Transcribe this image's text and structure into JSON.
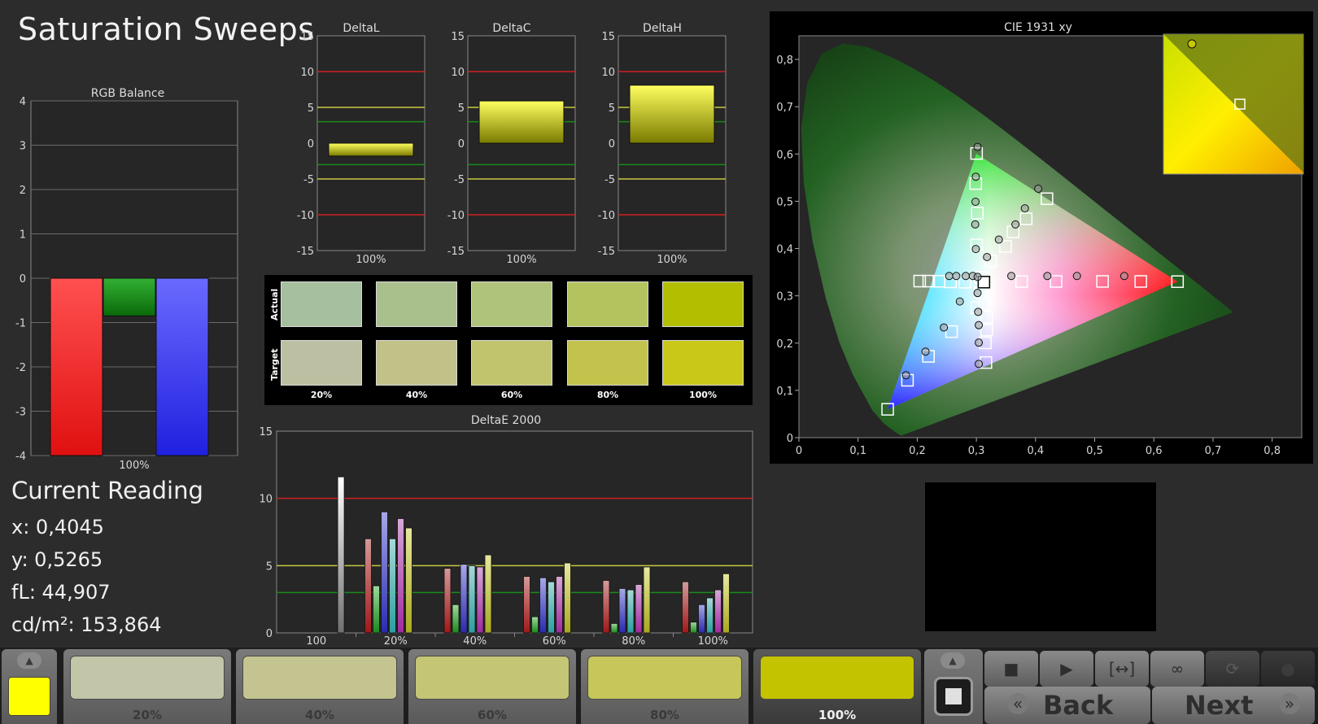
{
  "title": "Saturation Sweeps",
  "current_reading": {
    "heading": "Current Reading",
    "x": "x: 0,4045",
    "y": "y: 0,5265",
    "fl": "fL: 44,907",
    "cdm2": "cd/m²: 153,864"
  },
  "swatches": {
    "row_actual": "Actual",
    "row_target": "Target",
    "labels": [
      "20%",
      "40%",
      "60%",
      "80%",
      "100%"
    ],
    "actual_colors": [
      "#a6bf9e",
      "#aac08c",
      "#b0c37a",
      "#b4c35e",
      "#b3be00"
    ],
    "target_colors": [
      "#bdbfa2",
      "#c0c287",
      "#c1c46c",
      "#c2c24c",
      "#c9c718"
    ]
  },
  "bottom_bar": {
    "current_color": "#ffff00",
    "steps": [
      {
        "label": "20%",
        "color": "#c3c5a9"
      },
      {
        "label": "40%",
        "color": "#c3c48f"
      },
      {
        "label": "60%",
        "color": "#c4c575"
      },
      {
        "label": "80%",
        "color": "#c7c65a"
      },
      {
        "label": "100%",
        "color": "#c4c300",
        "active": true
      }
    ],
    "back_label": "Back",
    "next_label": "Next",
    "icons": [
      "stop-icon",
      "play-icon",
      "fit-icon",
      "loop-icon",
      "refresh-icon",
      "record-icon"
    ]
  },
  "chart_data": [
    {
      "id": "rgb",
      "type": "bar",
      "title": "RGB Balance",
      "categories": [
        "100%"
      ],
      "series": [
        {
          "color": "red",
          "values": [
            -4.0
          ]
        },
        {
          "color": "green",
          "values": [
            -0.85
          ]
        },
        {
          "color": "blue",
          "values": [
            -4.0
          ]
        }
      ],
      "ylim": [
        -4,
        4
      ],
      "yticks": [
        4,
        3,
        2,
        1,
        0,
        -1,
        -2,
        -3,
        -4
      ]
    },
    {
      "id": "deltaL",
      "type": "bar",
      "title": "DeltaL",
      "categories": [
        "100%"
      ],
      "values": [
        -1.8
      ],
      "ylim": [
        -15,
        15
      ],
      "yticks": [
        15,
        10,
        5,
        0,
        -5,
        -10,
        -15
      ]
    },
    {
      "id": "deltaC",
      "type": "bar",
      "title": "DeltaC",
      "categories": [
        "100%"
      ],
      "values": [
        5.9
      ],
      "ylim": [
        -15,
        15
      ],
      "yticks": [
        15,
        10,
        5,
        0,
        -5,
        -10,
        -15
      ]
    },
    {
      "id": "deltaH",
      "type": "bar",
      "title": "DeltaH",
      "categories": [
        "100%"
      ],
      "values": [
        8.1
      ],
      "ylim": [
        -15,
        15
      ],
      "yticks": [
        15,
        10,
        5,
        0,
        -5,
        -10,
        -15
      ]
    },
    {
      "id": "deltaE",
      "type": "bar",
      "title": "DeltaE 2000",
      "categories": [
        "100",
        "20%",
        "40%",
        "60%",
        "80%",
        "100%"
      ],
      "series": [
        {
          "color": "white",
          "values": [
            11.6,
            null,
            null,
            null,
            null,
            null
          ]
        },
        {
          "color": "red",
          "values": [
            null,
            7.0,
            4.8,
            4.2,
            3.9,
            3.8
          ]
        },
        {
          "color": "green",
          "values": [
            null,
            3.5,
            2.1,
            1.2,
            0.7,
            0.8
          ]
        },
        {
          "color": "blue",
          "values": [
            null,
            9.0,
            5.1,
            4.1,
            3.3,
            2.1
          ]
        },
        {
          "color": "cyan",
          "values": [
            null,
            7.0,
            5.0,
            3.8,
            3.2,
            2.6
          ]
        },
        {
          "color": "magenta",
          "values": [
            null,
            8.5,
            4.9,
            4.2,
            3.6,
            3.2
          ]
        },
        {
          "color": "yellow",
          "values": [
            null,
            7.8,
            5.8,
            5.2,
            4.9,
            4.4
          ]
        }
      ],
      "ylim": [
        0,
        15
      ],
      "yticks": [
        15,
        10,
        5,
        0
      ]
    },
    {
      "id": "cie",
      "type": "scatter",
      "title": "CIE 1931 xy",
      "xlim": [
        0,
        0.85
      ],
      "ylim": [
        0,
        0.85
      ],
      "xticks": [
        "0",
        "0,1",
        "0,2",
        "0,3",
        "0,4",
        "0,5",
        "0,6",
        "0,7",
        "0,8"
      ],
      "yticks": [
        "0",
        "0,1",
        "0,2",
        "0,3",
        "0,4",
        "0,5",
        "0,6",
        "0,7",
        "0,8"
      ],
      "gamut": [
        [
          0.64,
          0.33
        ],
        [
          0.3,
          0.6
        ],
        [
          0.15,
          0.06
        ]
      ],
      "white": [
        0.3127,
        0.329
      ],
      "targets": [
        [
          0.3067,
          0.3065
        ],
        [
          0.3137,
          0.2814
        ],
        [
          0.3174,
          0.2545
        ],
        [
          0.3173,
          0.2277
        ],
        [
          0.3151,
          0.2005
        ],
        [
          0.3161,
          0.1589
        ],
        [
          0.3069,
          0.3391
        ],
        [
          0.3005,
          0.4078
        ],
        [
          0.3015,
          0.4751
        ],
        [
          0.2989,
          0.5375
        ],
        [
          0.3003,
          0.6011
        ],
        [
          0.324,
          0.3728
        ],
        [
          0.3492,
          0.4044
        ],
        [
          0.362,
          0.4351
        ],
        [
          0.3842,
          0.4629
        ],
        [
          0.4193,
          0.5054
        ],
        [
          0.2807,
          0.3288
        ],
        [
          0.2563,
          0.3295
        ],
        [
          0.2366,
          0.3308
        ],
        [
          0.2194,
          0.3311
        ],
        [
          0.2041,
          0.3312
        ],
        [
          0.3009,
          0.2752
        ],
        [
          0.258,
          0.2243
        ],
        [
          0.219,
          0.172
        ],
        [
          0.1835,
          0.1214
        ],
        [
          0.15,
          0.06
        ],
        [
          0.3764,
          0.3301
        ],
        [
          0.4347,
          0.3304
        ],
        [
          0.5132,
          0.3305
        ],
        [
          0.5779,
          0.3304
        ],
        [
          0.64,
          0.33
        ]
      ],
      "measured": [
        [
          0.302,
          0.615
        ],
        [
          0.299,
          0.552
        ],
        [
          0.2985,
          0.499
        ],
        [
          0.298,
          0.451
        ],
        [
          0.299,
          0.399
        ],
        [
          0.318,
          0.382
        ],
        [
          0.338,
          0.419
        ],
        [
          0.366,
          0.451
        ],
        [
          0.382,
          0.485
        ],
        [
          0.4045,
          0.5265
        ],
        [
          0.254,
          0.342
        ],
        [
          0.266,
          0.342
        ],
        [
          0.282,
          0.342
        ],
        [
          0.294,
          0.342
        ],
        [
          0.302,
          0.34
        ],
        [
          0.302,
          0.306
        ],
        [
          0.272,
          0.288
        ],
        [
          0.245,
          0.233
        ],
        [
          0.214,
          0.182
        ],
        [
          0.181,
          0.132
        ],
        [
          0.303,
          0.266
        ],
        [
          0.304,
          0.238
        ],
        [
          0.304,
          0.201
        ],
        [
          0.304,
          0.156
        ],
        [
          0.359,
          0.342
        ],
        [
          0.42,
          0.342
        ],
        [
          0.47,
          0.342
        ],
        [
          0.55,
          0.342
        ]
      ]
    }
  ]
}
